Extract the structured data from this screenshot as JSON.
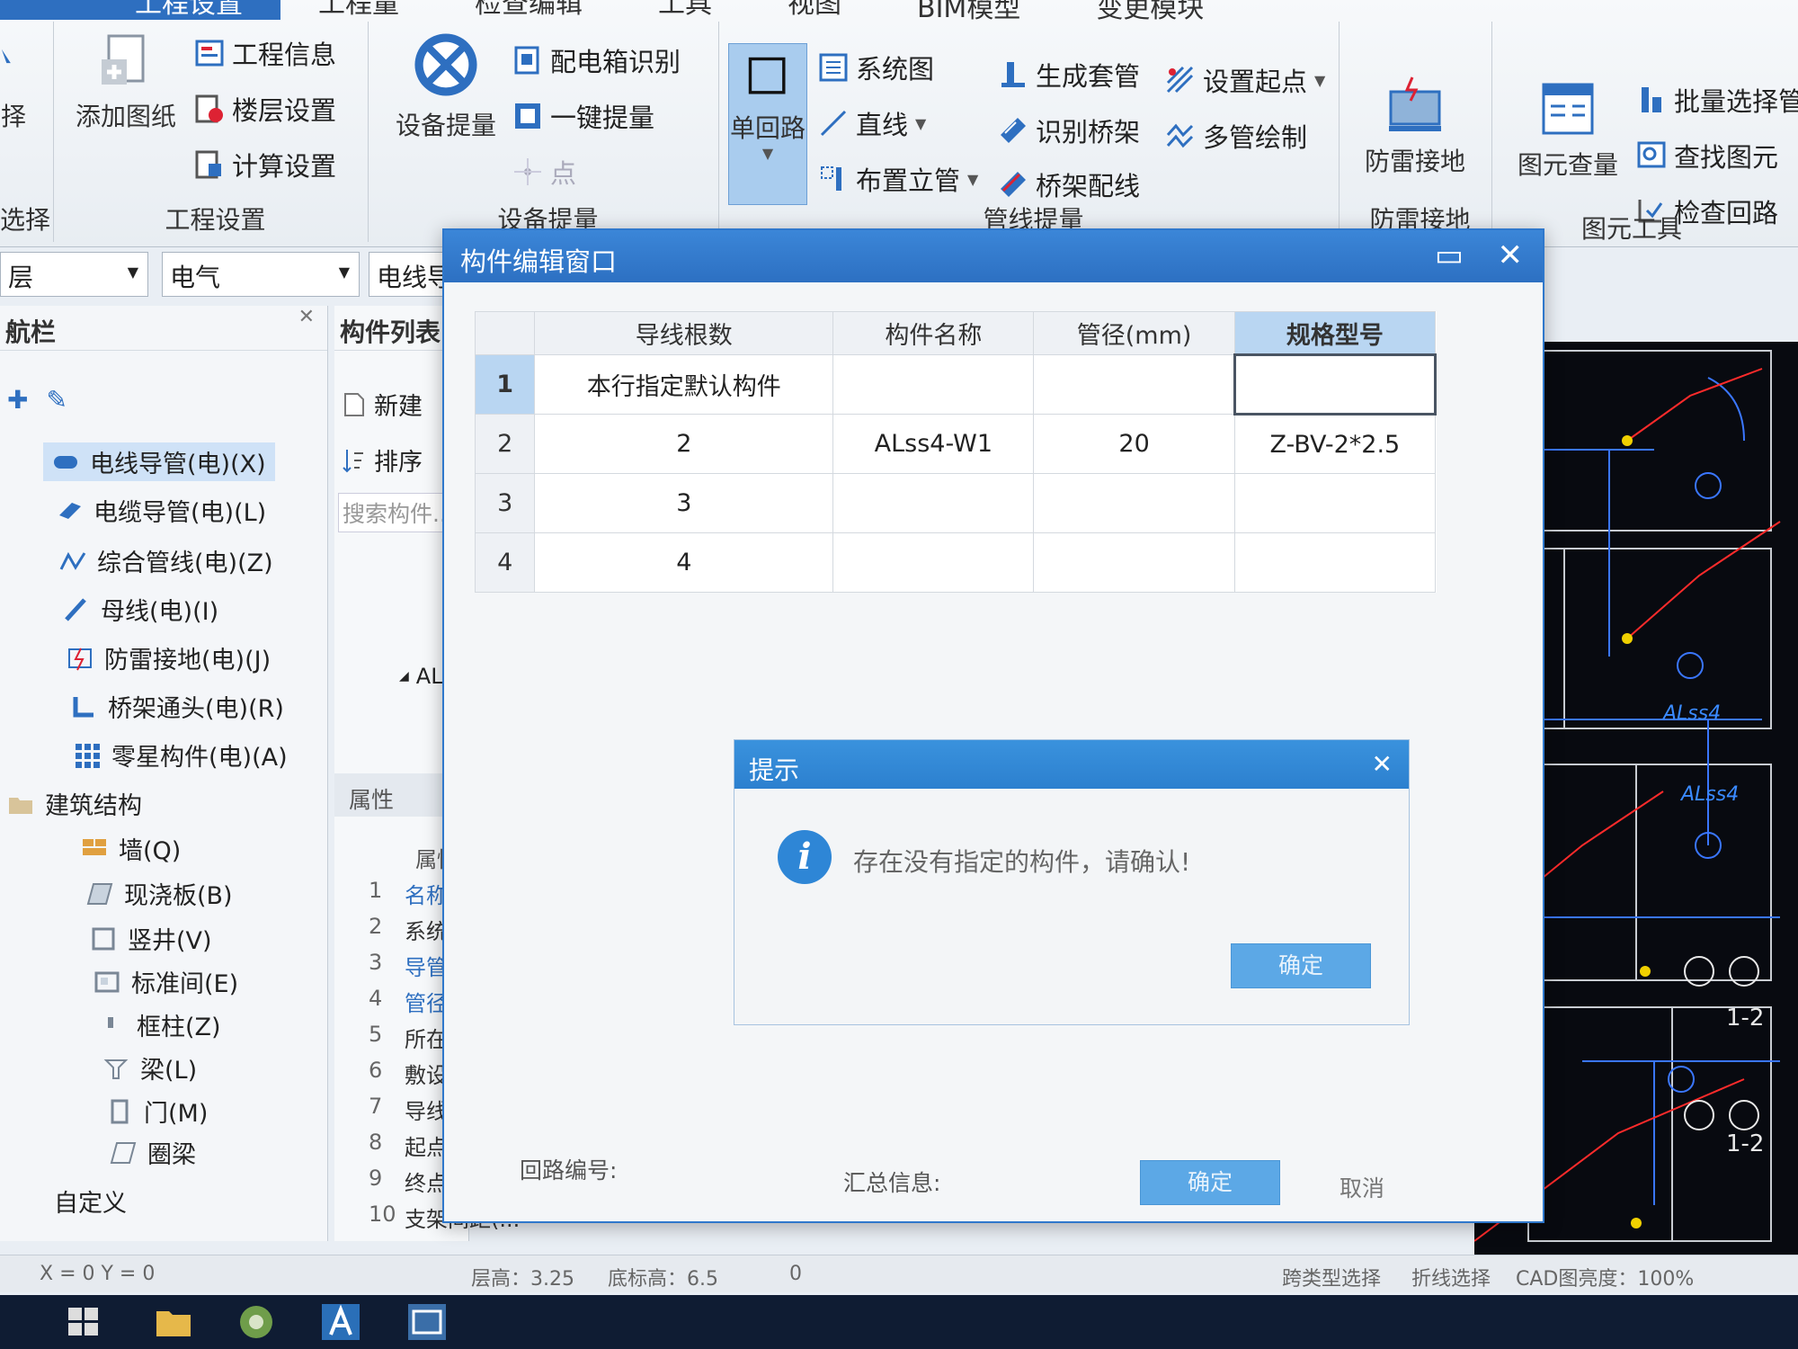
{
  "menu": {
    "tabs": [
      "工程设置",
      "工程量",
      "检查编辑",
      "工具",
      "视图",
      "BIM模型",
      "变更模块"
    ],
    "active_index": 0
  },
  "ribbon": {
    "left_partial": {
      "select_label": "择",
      "select_group_label": "选择"
    },
    "project_settings": {
      "add_drawing": "添加图纸",
      "project_info": "工程信息",
      "floor_settings": "楼层设置",
      "calc_settings": "计算设置",
      "group_label": "工程设置"
    },
    "device_takeoff": {
      "device_takeoff": "设备提量",
      "panel_recognition": "配电箱识别",
      "one_key_takeoff": "一键提量",
      "point": "点",
      "group_label": "设备提量"
    },
    "pipeline_takeoff": {
      "single_loop": "单回路",
      "system_diagram": "系统图",
      "straight_line": "直线",
      "place_riser": "布置立管",
      "generate_sleeve": "生成套管",
      "identify_tray": "识别桥架",
      "tray_wiring": "桥架配线",
      "set_start_point": "设置起点",
      "multi_pipe_draw": "多管绘制",
      "group_label": "管线提量"
    },
    "lightning": {
      "label": "防雷接地",
      "group_label": "防雷接地"
    },
    "element_tools": {
      "element_query": "图元查量",
      "batch_select": "批量选择管",
      "find_element": "查找图元",
      "check_loop": "检查回路",
      "group_label": "图元工具"
    }
  },
  "selectors": {
    "floor": "层",
    "discipline": "电气",
    "component_type": "电线导"
  },
  "nav": {
    "title": "航栏",
    "items": [
      {
        "label": "电线导管(电)(X)",
        "active": true
      },
      {
        "label": "电缆导管(电)(L)"
      },
      {
        "label": "综合管线(电)(Z)"
      },
      {
        "label": "母线(电)(I)"
      },
      {
        "label": "防雷接地(电)(J)"
      },
      {
        "label": "桥架通头(电)(R)"
      },
      {
        "label": "零星构件(电)(A)"
      }
    ],
    "section_building": "建筑结构",
    "building_items": [
      "墙(Q)",
      "现浇板(B)",
      "竖井(V)",
      "标准间(E)",
      "框柱(Z)",
      "梁(L)",
      "门(M)",
      "圈梁"
    ],
    "custom": "自定义"
  },
  "component_list": {
    "title": "构件列表",
    "new": "新建",
    "sort": "排序",
    "search_placeholder": "搜索构件...",
    "tree_node": "AL",
    "properties_title": "属性",
    "prop_header": "属性",
    "props": [
      {
        "n": "1",
        "k": "名称"
      },
      {
        "n": "2",
        "k": "系统类"
      },
      {
        "n": "3",
        "k": "导管材"
      },
      {
        "n": "4",
        "k": "管径("
      },
      {
        "n": "5",
        "k": "所在位"
      },
      {
        "n": "6",
        "k": "敷设方"
      },
      {
        "n": "7",
        "k": "导线规"
      },
      {
        "n": "8",
        "k": "起点标"
      },
      {
        "n": "9",
        "k": "终点标"
      },
      {
        "n": "10",
        "k": "支架间距(..."
      }
    ]
  },
  "edit_window": {
    "title": "构件编辑窗口",
    "columns": [
      "导线根数",
      "构件名称",
      "管径(mm)",
      "规格型号"
    ],
    "rows": [
      {
        "num": "1",
        "wires": "本行指定默认构件",
        "name": "",
        "dia": "",
        "spec": ""
      },
      {
        "num": "2",
        "wires": "2",
        "name": "ALss4-W1",
        "dia": "20",
        "spec": "Z-BV-2*2.5"
      },
      {
        "num": "3",
        "wires": "3",
        "name": "",
        "dia": "",
        "spec": ""
      },
      {
        "num": "4",
        "wires": "4",
        "name": "",
        "dia": "",
        "spec": ""
      }
    ],
    "loop_no_label": "回路编号:",
    "summary_label": "汇总信息:",
    "ok": "确定",
    "cancel": "取消"
  },
  "prompt": {
    "title": "提示",
    "message": "存在没有指定的构件，请确认!",
    "ok": "确定"
  },
  "status": {
    "coords": "X = 0 Y = 0",
    "floor_height": "层高：3.25",
    "base_elev": "底标高：6.5",
    "zero": "0",
    "cross_type_select": "跨类型选择",
    "polyline_select": "折线选择",
    "cad_brightness": "CAD图亮度：100%"
  },
  "cad_labels": [
    "ALss4",
    "ALss4",
    "1-2",
    "1-2"
  ],
  "colors": {
    "accent": "#2e6fc0",
    "dialog_title": "#2c80cf",
    "cad_bg": "#080a10"
  }
}
